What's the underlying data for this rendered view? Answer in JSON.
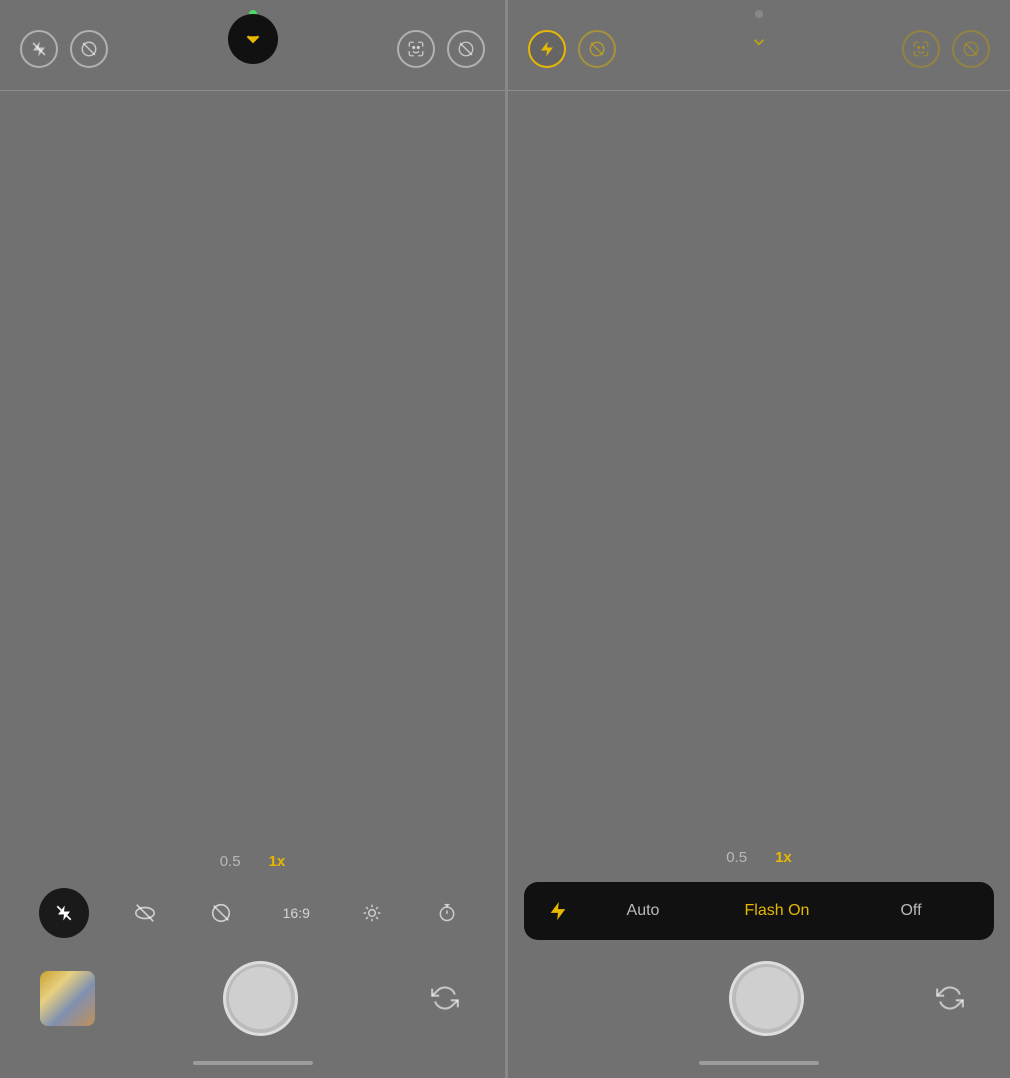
{
  "panels": {
    "left": {
      "status_dot_color": "#4cd964",
      "top_bar": {
        "flash_icon": "⚡",
        "flash_icon_label": "flash-off",
        "live_icon_label": "live-off",
        "chevron_icon_label": "chevron-down",
        "face_icon_label": "face-detection",
        "camera_icon_label": "camera-settings"
      },
      "zoom": {
        "wide": "0.5",
        "normal": "1x"
      },
      "toolbar": {
        "flash_label": "flash-active",
        "hdr_label": "hdr",
        "live_label": "live",
        "ratio_label": "16:9",
        "exposure_label": "exposure",
        "timer_label": "timer"
      },
      "shutter": {
        "has_thumbnail": true,
        "flip_label": "flip-camera"
      },
      "home_bar": true
    },
    "right": {
      "status_dot_color": "#888",
      "top_bar": {
        "flash_icon": "⚡",
        "flash_icon_label": "flash-on",
        "live_icon_label": "live-off",
        "chevron_icon_label": "chevron-down",
        "face_icon_label": "face-detection",
        "camera_icon_label": "camera-settings"
      },
      "zoom": {
        "wide": "0.5",
        "normal": "1x"
      },
      "flash_menu": {
        "auto_label": "Auto",
        "on_label": "Flash On",
        "off_label": "Off"
      },
      "shutter": {
        "has_thumbnail": false,
        "flip_label": "flip-camera"
      },
      "home_bar": true
    }
  }
}
